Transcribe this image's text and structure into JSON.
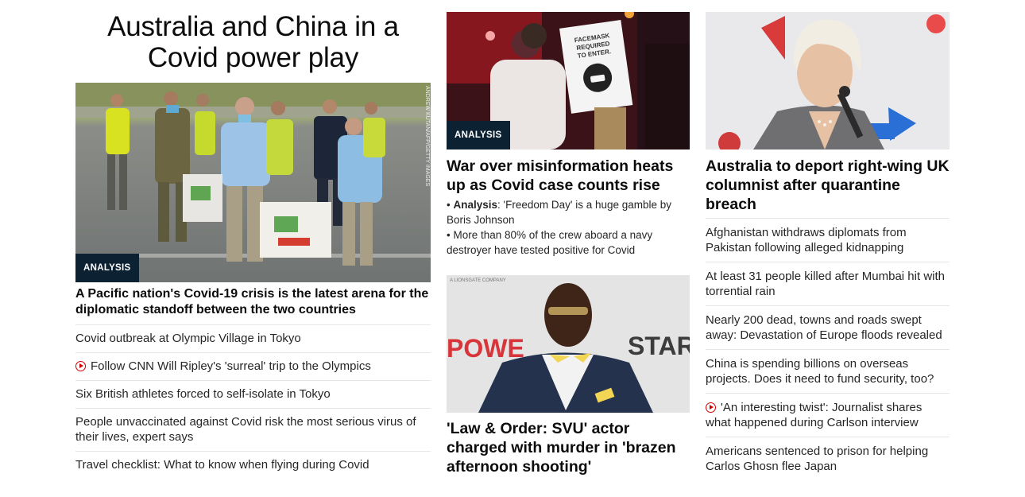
{
  "left": {
    "headline": "Australia and China in a Covid power play",
    "badge": "ANALYSIS",
    "photo_credit": "ANDREW KUTAN/AFP/GETTY IMAGES",
    "caption": "A Pacific nation's Covid-19 crisis is the latest arena for the diplomatic standoff between the two countries",
    "stories": [
      {
        "text": "Covid outbreak at Olympic Village in Tokyo",
        "video": false
      },
      {
        "text": "Follow CNN Will Ripley's 'surreal' trip to the Olympics",
        "video": true
      },
      {
        "text": "Six British athletes forced to self-isolate in Tokyo",
        "video": false
      },
      {
        "text": "People unvaccinated against Covid risk the most serious virus of their lives, expert says",
        "video": false
      },
      {
        "text": "Travel checklist: What to know when flying during Covid",
        "video": false
      }
    ]
  },
  "middle": {
    "top": {
      "badge": "ANALYSIS",
      "sign_text": "FACEMASK REQUIRED TO ENTER.",
      "headline": "War over misinformation heats up as Covid case counts rise",
      "sub1_bold": "Analysis",
      "sub1_rest": ": 'Freedom Day' is a huge gamble by Boris Johnson",
      "sub2": "More than 80% of the crew aboard a navy destroyer have tested positive for Covid"
    },
    "bottom": {
      "backdrop_top": "A LIONSGATE COMPANY",
      "backdrop_left": "POWE",
      "backdrop_right": "STAR",
      "headline": "'Law & Order: SVU' actor charged with murder in 'brazen afternoon shooting'"
    }
  },
  "right": {
    "headline": "Australia to deport right-wing UK columnist after quarantine breach",
    "stories": [
      {
        "text": "Afghanistan withdraws diplomats from Pakistan following alleged kidnapping",
        "video": false
      },
      {
        "text": "At least 31 people killed after Mumbai hit with torrential rain",
        "video": false
      },
      {
        "text": "Nearly 200 dead, towns and roads swept away: Devastation of Europe floods revealed",
        "video": false
      },
      {
        "text": "China is spending billions on overseas projects. Does it need to fund security, too?",
        "video": false
      },
      {
        "text": "'An interesting twist': Journalist shares what happened during Carlson interview",
        "video": true
      },
      {
        "text": "Americans sentenced to prison for helping Carlos Ghosn flee Japan",
        "video": false
      }
    ]
  },
  "colors": {
    "badge_bg": "#0c2132",
    "video_icon": "#cc0000",
    "divider": "#e6e6e6"
  }
}
